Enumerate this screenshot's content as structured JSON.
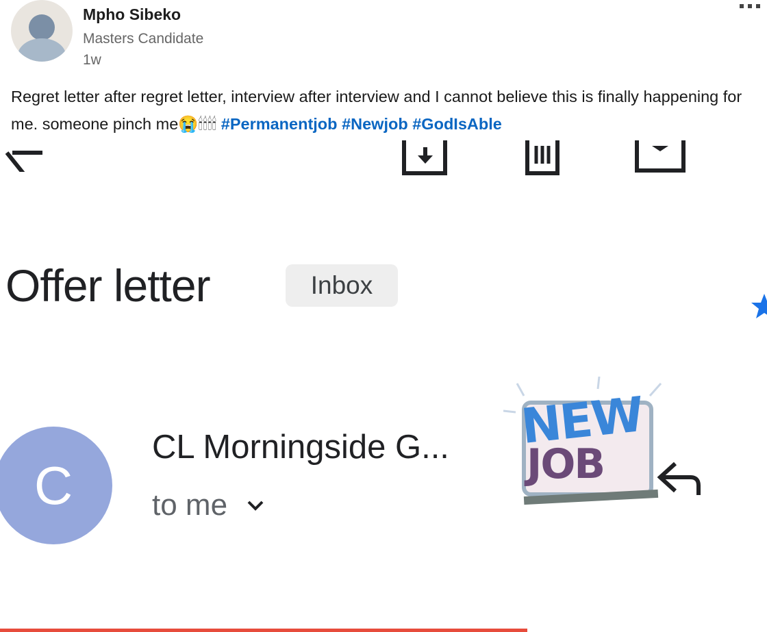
{
  "post": {
    "author_name": "Mpho Sibeko",
    "author_headline": "Masters Candidate",
    "time_ago": "1w",
    "body_text": "Regret letter after regret letter, interview after interview and I cannot believe this is finally happening for me. someone pinch me😭🕯🕯🕯🕯",
    "hashtags": [
      "#Permanentjob",
      "#Newjob",
      "#GodIsAble"
    ],
    "more_menu_icon": "ellipsis-icon"
  },
  "email": {
    "toolbar_icons": [
      "back-arrow-icon",
      "archive-icon",
      "delete-icon",
      "mail-icon"
    ],
    "subject": "Offer letter",
    "label_chip": "Inbox",
    "star_icon": "star-icon",
    "sender_initial": "C",
    "sender_name": "CL Morningside G...",
    "recipient": "to me",
    "reply_icon": "reply-icon",
    "sticker_top": "NEW",
    "sticker_bottom": "JOB",
    "colors": {
      "hashtag": "#0a66c2",
      "avatar": "#95a7dc",
      "sticker_new": "#3a86d9",
      "sticker_job": "#6b4a78",
      "star": "#1a73e8"
    }
  }
}
